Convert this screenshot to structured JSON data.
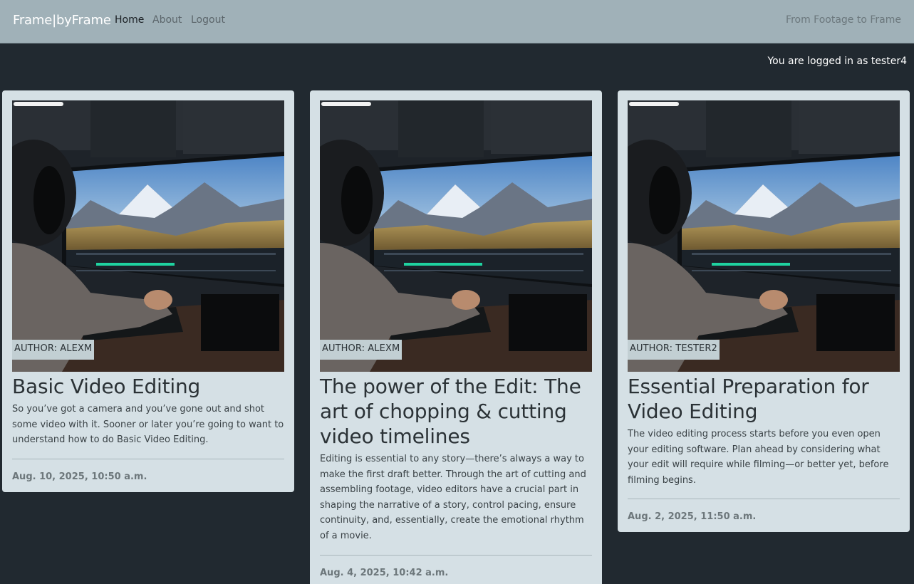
{
  "navbar": {
    "brand": "Frame|byFrame",
    "links": [
      {
        "label": "Home",
        "active": true
      },
      {
        "label": "About",
        "active": false
      },
      {
        "label": "Logout",
        "active": false
      }
    ],
    "tagline": "From Footage to Frame"
  },
  "status": {
    "logged_in_text": "You are logged in as tester4"
  },
  "posts": [
    {
      "author": "AUTHOR: ALEXM",
      "title": "Basic Video Editing",
      "excerpt": "So you’ve got a camera and you’ve gone out and shot some video with it. Sooner or later you’re going to want to understand how to do Basic Video Editing.",
      "date": "Aug. 10, 2025, 10:50 a.m."
    },
    {
      "author": "AUTHOR: ALEXM",
      "title": "The power of the Edit: The art of chopping & cutting video timelines",
      "excerpt": "Editing is essential to any story—there’s always a way to make the first draft better. Through the art of cutting and assembling footage, video editors have a crucial part in shaping the narrative of a story, control pacing, ensure continuity, and, essentially, create the emotional rhythm of a movie.",
      "date": "Aug. 4, 2025, 10:42 a.m."
    },
    {
      "author": "AUTHOR: TESTER2",
      "title": "Essential Preparation for Video Editing",
      "excerpt": "The video editing process starts before you even open your editing software. Plan ahead by considering what your edit will require while filming—or better yet, before filming begins.",
      "date": "Aug. 2, 2025, 11:50 a.m."
    }
  ],
  "colors": {
    "navbar_bg": "#a0b1b8",
    "page_bg": "#212930",
    "card_bg": "#d5e0e5"
  }
}
